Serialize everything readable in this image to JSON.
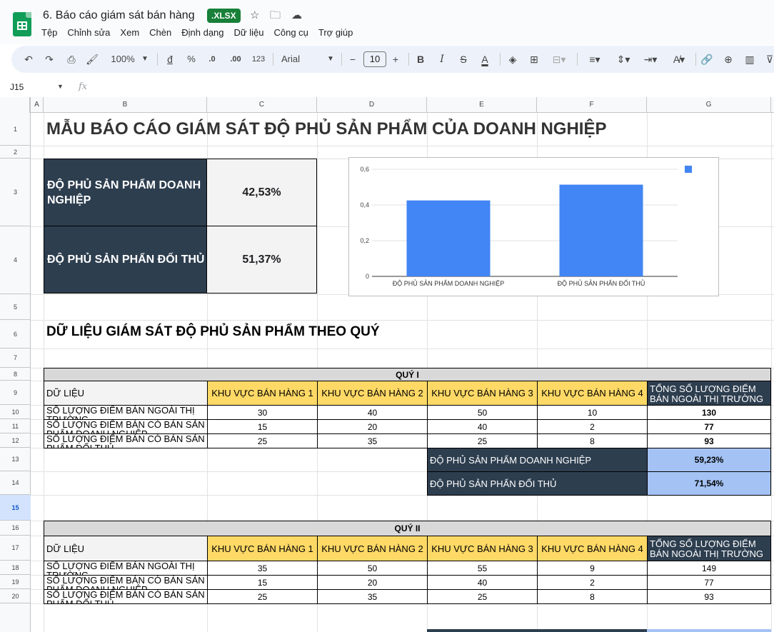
{
  "app": {
    "doc_title": "6. Báo cáo giám sát bán hàng",
    "file_badge": ".XLSX",
    "menu": [
      "Tệp",
      "Chỉnh sửa",
      "Xem",
      "Chèn",
      "Định dạng",
      "Dữ liệu",
      "Công cụ",
      "Trợ giúp"
    ]
  },
  "toolbar": {
    "zoom": "100%",
    "currency": "đ",
    "percent": "%",
    "decrease_decimal": ".0",
    "increase_decimal": ".00",
    "number_format": "123",
    "font": "Arial",
    "font_size": "10",
    "bold": "B",
    "italic": "I",
    "strike": "S",
    "text_color": "A",
    "minus": "−",
    "plus": "+"
  },
  "formula_bar": {
    "name_box": "J15",
    "fx": "fx"
  },
  "columns": [
    "A",
    "B",
    "C",
    "D",
    "E",
    "F",
    "G"
  ],
  "rows": [
    "1",
    "2",
    "3",
    "4",
    "5",
    "6",
    "7",
    "8",
    "9",
    "10",
    "11",
    "12",
    "13",
    "14",
    "15",
    "16",
    "17",
    "18",
    "19",
    "20"
  ],
  "sheet": {
    "main_title": "MẪU BÁO CÁO GIÁM SÁT ĐỘ PHỦ SẢN PHẨM CỦA DOANH NGHIỆP",
    "kpi": [
      {
        "label": "ĐỘ PHỦ SẢN PHẨM DOANH NGHIỆP",
        "value": "42,53%"
      },
      {
        "label": "ĐỘ PHỦ SẢN PHẨN ĐỐI THỦ",
        "value": "51,37%"
      }
    ],
    "section_title": "DỮ LIỆU GIÁM SÁT ĐỘ PHỦ SẢN PHẨM THEO QUÝ",
    "quarters": [
      {
        "name": "QUÝ I",
        "col_header_data": "DỮ LIỆU",
        "region_headers": [
          "KHU VỰC BÁN HÀNG 1",
          "KHU VỰC BÁN HÀNG 2",
          "KHU VỰC BÁN HÀNG 3",
          "KHU VỰC BÁN HÀNG 4"
        ],
        "total_header": "TỔNG SỐ LƯỢNG ĐIỂM BÁN NGOÀI THỊ TRƯỜNG",
        "rows": [
          {
            "label": "SỐ LƯỢNG ĐIỂM BÁN NGOÀI THỊ TRƯỜNG",
            "values": [
              "30",
              "40",
              "50",
              "10"
            ],
            "total": "130"
          },
          {
            "label": "SỐ LƯỢNG ĐIỂM BÁN CÓ BÁN SẢN PHẨM DOANH NGHIỆP",
            "values": [
              "15",
              "20",
              "40",
              "2"
            ],
            "total": "77"
          },
          {
            "label": "SỐ LƯỢNG ĐIỂM BÁN CÓ BÁN SẢN PHẨM ĐỐI THỦ",
            "values": [
              "25",
              "35",
              "25",
              "8"
            ],
            "total": "93"
          }
        ],
        "summary": [
          {
            "label": "ĐỘ PHỦ SẢN PHẨM DOANH NGHIỆP",
            "value": "59,23%"
          },
          {
            "label": "ĐỘ PHỦ SẢN PHẨN ĐỐI THỦ",
            "value": "71,54%"
          }
        ]
      },
      {
        "name": "QUÝ II",
        "col_header_data": "DỮ LIỆU",
        "region_headers": [
          "KHU VỰC BÁN HÀNG 1",
          "KHU VỰC BÁN HÀNG 2",
          "KHU VỰC BÁN HÀNG 3",
          "KHU VỰC BÁN HÀNG 4"
        ],
        "total_header": "TỔNG SỐ LƯỢNG ĐIỂM BÁN NGOÀI THỊ TRƯỜNG",
        "rows": [
          {
            "label": "SỐ LƯỢNG ĐIỂM BÁN NGOÀI THỊ TRƯỜNG",
            "values": [
              "35",
              "50",
              "55",
              "9"
            ],
            "total": "149"
          },
          {
            "label": "SỐ LƯỢNG ĐIỂM BÁN CÓ BÁN SẢN PHẨM DOANH NGHIỆP",
            "values": [
              "15",
              "20",
              "40",
              "2"
            ],
            "total": "77"
          },
          {
            "label": "SỐ LƯỢNG ĐIỂM BÁN CÓ BÁN SẢN PHẨM ĐỐI THỦ",
            "values": [
              "25",
              "35",
              "25",
              "8"
            ],
            "total": "93"
          }
        ]
      }
    ]
  },
  "chart_data": {
    "type": "bar",
    "categories": [
      "ĐỘ PHỦ SẢN PHẨM DOANH NGHIỆP",
      "ĐỘ PHỦ SẢN PHẨN ĐỐI THỦ"
    ],
    "values": [
      0.4253,
      0.5137
    ],
    "y_ticks": [
      "0",
      "0,2",
      "0,4",
      "0,6"
    ],
    "ylim": [
      0,
      0.6
    ],
    "bar_color": "#4285f4",
    "grid": true,
    "legend": "top-right",
    "title": "",
    "xlabel": "",
    "ylabel": ""
  },
  "colors": {
    "navy": "#2d3e4f",
    "yellow": "#ffd966",
    "light_blue": "#a4c2f4",
    "sheets_green": "#0f9d58",
    "selected_row": "#d3e3fd"
  }
}
